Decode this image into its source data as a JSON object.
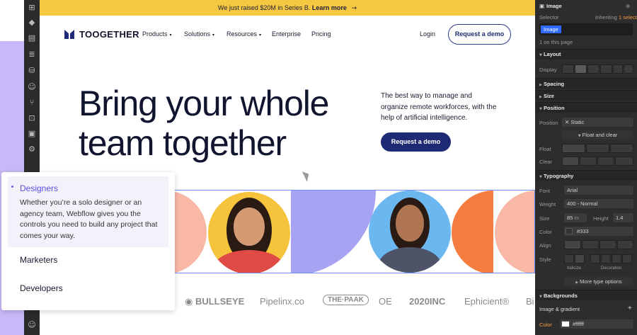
{
  "banner": {
    "text": "We just raised $20M in Series B.",
    "link": "Learn more",
    "arrow": "→"
  },
  "nav": {
    "brand": "TOOGETHER",
    "items": [
      {
        "label": "Products",
        "chev": "▾"
      },
      {
        "label": "Solutions",
        "chev": "▾"
      },
      {
        "label": "Resources",
        "chev": "▾"
      },
      {
        "label": "Enterprise",
        "chev": ""
      },
      {
        "label": "Pricing",
        "chev": ""
      }
    ],
    "login": "Login",
    "cta": "Request a demo"
  },
  "hero": {
    "title": "Bring your whole team together",
    "description": "The best way to manage and organize remote workforces, with the help of artificial intelligence.",
    "cta": "Request a demo"
  },
  "logos": [
    "BULLSEYE",
    "Pipelinx.co",
    "THE·PAAK",
    "OE",
    "2020INC",
    "Ephicient®",
    "Bi"
  ],
  "card": {
    "active_title": "Designers",
    "active_body": "Whether you’re a solo designer or an agency team, Webflow gives you the controls you need to build any project that comes your way.",
    "items": [
      "Marketers",
      "Developers"
    ]
  },
  "panel": {
    "element": "Image",
    "selector_label": "Selector",
    "inheriting_prefix": "Inheriting",
    "inheriting_count": "1 selector",
    "selector_chip": "Image",
    "on_page": "1 on this page",
    "layout": "Layout",
    "display": "Display",
    "spacing": "Spacing",
    "size": "Size",
    "position": "Position",
    "position_label": "Position",
    "position_value": "Static",
    "float_and_clear": "Float and clear",
    "float": "Float",
    "clear": "Clear",
    "typography": "Typography",
    "font_label": "Font",
    "font_value": "Arial",
    "weight_label": "Weight",
    "weight_value": "400 - Normal",
    "size_label": "Size",
    "size_value": "85",
    "size_unit": "PX",
    "height_label": "Height",
    "height_value": "1.4",
    "color_label": "Color",
    "color_value": "#333",
    "align_label": "Align",
    "style_label": "Style",
    "italicize": "Italicize",
    "decoration": "Decoration",
    "more_type": "More type options",
    "backgrounds": "Backgrounds",
    "image_gradient": "Image & gradient",
    "bg_color_label": "Color",
    "bg_color_value": "#ffffff"
  },
  "colors": {
    "banner": "#f5c842",
    "navy": "#1f2a75",
    "accent_purple": "#5b4ee0",
    "panel_bg": "#2d2d2d",
    "selection_blue": "#2f6bff"
  }
}
